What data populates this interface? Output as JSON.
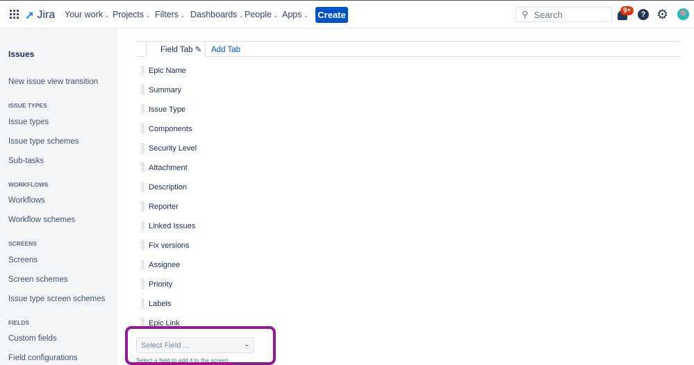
{
  "nav": {
    "app": "Jira",
    "items": [
      "Your work",
      "Projects",
      "Filters",
      "Dashboards",
      "People",
      "Apps"
    ],
    "create": "Create",
    "search_placeholder": "Search",
    "notif_badge": "9+",
    "help": "?"
  },
  "sidebar": {
    "title": "Issues",
    "link": "New issue view transition",
    "sections": [
      {
        "heading": "ISSUE TYPES",
        "items": [
          "Issue types",
          "Issue type schemes",
          "Sub-tasks"
        ]
      },
      {
        "heading": "WORKFLOWS",
        "items": [
          "Workflows",
          "Workflow schemes"
        ]
      },
      {
        "heading": "SCREENS",
        "items": [
          "Screens",
          "Screen schemes",
          "Issue type screen schemes"
        ]
      },
      {
        "heading": "FIELDS",
        "items": [
          "Custom fields",
          "Field configurations"
        ]
      }
    ]
  },
  "tabs": {
    "active": "Field Tab",
    "add": "Add Tab"
  },
  "fields": [
    "Epic Name",
    "Summary",
    "Issue Type",
    "Components",
    "Security Level",
    "Attachment",
    "Description",
    "Reporter",
    "Linked Issues",
    "Fix versions",
    "Assignee",
    "Priority",
    "Labels",
    "Epic Link"
  ],
  "select": {
    "placeholder": "Select Field ...",
    "hint": "Select a field to add it to the screen."
  }
}
